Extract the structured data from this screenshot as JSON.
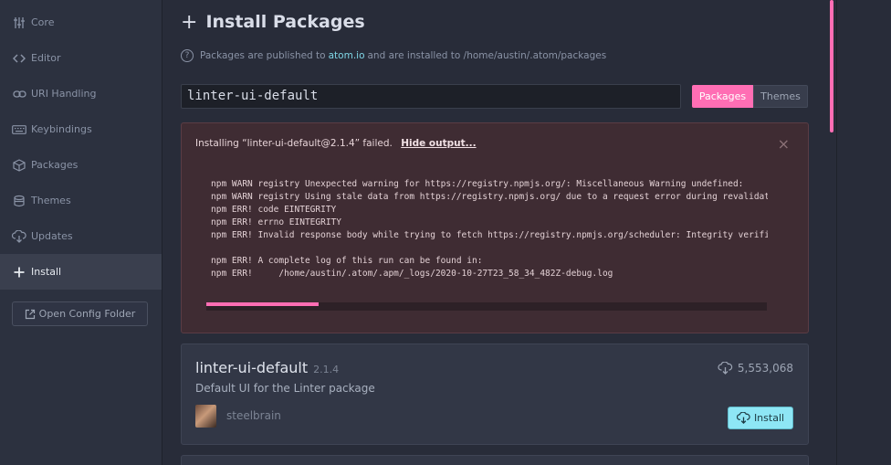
{
  "sidebar": {
    "items": [
      {
        "label": "Core",
        "icon": "sliders-icon"
      },
      {
        "label": "Editor",
        "icon": "code-icon"
      },
      {
        "label": "URI Handling",
        "icon": "link-icon"
      },
      {
        "label": "Keybindings",
        "icon": "keyboard-icon"
      },
      {
        "label": "Packages",
        "icon": "package-icon"
      },
      {
        "label": "Themes",
        "icon": "paintcan-icon"
      },
      {
        "label": "Updates",
        "icon": "cloud-download-icon"
      },
      {
        "label": "Install",
        "icon": "plus-icon",
        "active": true
      }
    ],
    "open_config_label": "Open Config Folder"
  },
  "main": {
    "title": "Install Packages",
    "info": {
      "prefix": "Packages are published to",
      "link": "atom.io",
      "suffix": "and are installed to /home/austin/.atom/packages"
    },
    "search": {
      "value": "linter-ui-default"
    },
    "toggle": {
      "packages_label": "Packages",
      "themes_label": "Themes",
      "selected": "Packages"
    },
    "error": {
      "message": "Installing “linter-ui-default@2.1.4” failed.",
      "hide_label": "Hide output...",
      "close_glyph": "×",
      "log": "npm WARN registry Unexpected warning for https://registry.npmjs.org/: Miscellaneous Warning undefined:\nnpm WARN registry Using stale data from https://registry.npmjs.org/ due to a request error during revalidation.\nnpm ERR! code EINTEGRITY\nnpm ERR! errno EINTEGRITY\nnpm ERR! Invalid response body while trying to fetch https://registry.npmjs.org/scheduler: Integrity verification failed\n\nnpm ERR! A complete log of this run can be found in:\nnpm ERR!     /home/austin/.atom/.apm/_logs/2020-10-27T23_58_34_482Z-debug.log",
      "scroll_position": 0.2
    },
    "package": {
      "name": "linter-ui-default",
      "version": "2.1.4",
      "downloads": "5,553,068",
      "description": "Default UI for the Linter package",
      "owner": "steelbrain",
      "install_label": "Install"
    }
  },
  "colors": {
    "accent": "#ff6eb4",
    "install_button": "#8ee6f5",
    "link": "#7fd6e6",
    "error_bg": "#3f2c33"
  }
}
